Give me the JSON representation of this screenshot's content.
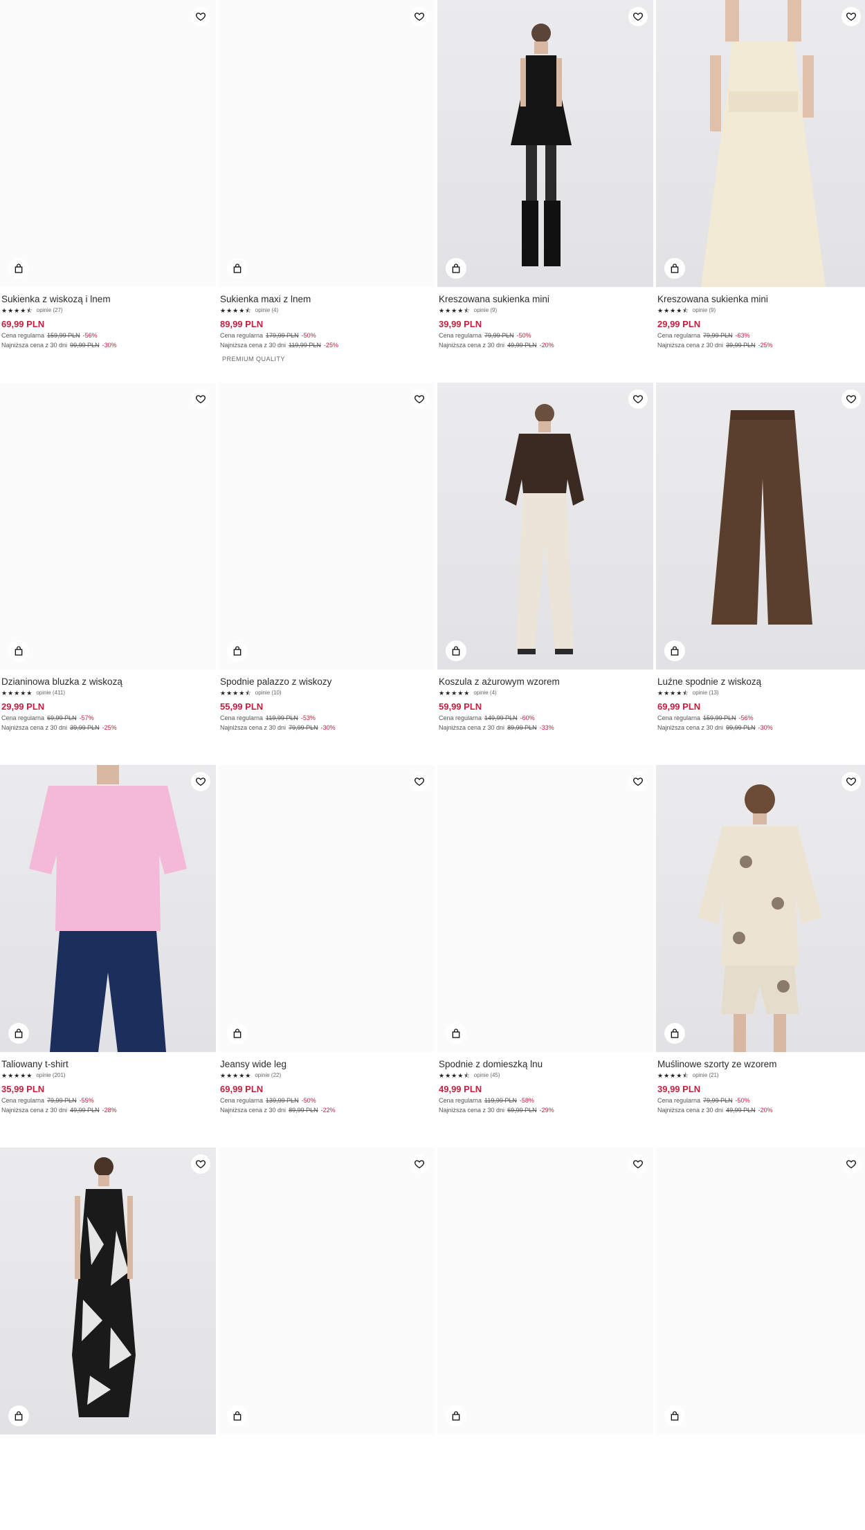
{
  "labels": {
    "regular": "Cena regularna",
    "lowest30": "Najniższa cena z 30 dni"
  },
  "colors": {
    "price": "#c3203f",
    "text": "#2b2b2b"
  },
  "icons": {
    "favorite": "heart-icon",
    "cart": "shopping-bag-icon",
    "star": "star-icon"
  },
  "products": [
    {
      "name": "Sukienka z wiskozą i lnem",
      "stars": "★★★★⯪",
      "reviews": "opinie (27)",
      "price": "69,99 PLN",
      "regular_price": "159,99 PLN",
      "regular_discount": "-56%",
      "lowest_price": "99,99 PLN",
      "lowest_discount": "-30%",
      "tag": ""
    },
    {
      "name": "Sukienka maxi z lnem",
      "stars": "★★★★⯪",
      "reviews": "opinie (4)",
      "price": "89,99 PLN",
      "regular_price": "179,99 PLN",
      "regular_discount": "-50%",
      "lowest_price": "119,99 PLN",
      "lowest_discount": "-25%",
      "tag": "PREMIUM QUALITY"
    },
    {
      "name": "Kreszowana sukienka mini",
      "stars": "★★★★⯪",
      "reviews": "opinie (9)",
      "price": "39,99 PLN",
      "regular_price": "79,99 PLN",
      "regular_discount": "-50%",
      "lowest_price": "49,99 PLN",
      "lowest_discount": "-20%",
      "tag": ""
    },
    {
      "name": "Kreszowana sukienka mini",
      "stars": "★★★★⯪",
      "reviews": "opinie (9)",
      "price": "29,99 PLN",
      "regular_price": "79,99 PLN",
      "regular_discount": "-63%",
      "lowest_price": "39,99 PLN",
      "lowest_discount": "-25%",
      "tag": ""
    },
    {
      "name": "Dzianinowa bluzka z wiskozą",
      "stars": "★★★★★",
      "reviews": "opinie (411)",
      "price": "29,99 PLN",
      "regular_price": "69,99 PLN",
      "regular_discount": "-57%",
      "lowest_price": "39,99 PLN",
      "lowest_discount": "-25%",
      "tag": ""
    },
    {
      "name": "Spodnie palazzo z wiskozy",
      "stars": "★★★★⯪",
      "reviews": "opinie (10)",
      "price": "55,99 PLN",
      "regular_price": "119,99 PLN",
      "regular_discount": "-53%",
      "lowest_price": "79,99 PLN",
      "lowest_discount": "-30%",
      "tag": ""
    },
    {
      "name": "Koszula z ażurowym wzorem",
      "stars": "★★★★★",
      "reviews": "opinie (4)",
      "price": "59,99 PLN",
      "regular_price": "149,99 PLN",
      "regular_discount": "-60%",
      "lowest_price": "89,99 PLN",
      "lowest_discount": "-33%",
      "tag": ""
    },
    {
      "name": "Luźne spodnie z wiskozą",
      "stars": "★★★★⯪",
      "reviews": "opinie (13)",
      "price": "69,99 PLN",
      "regular_price": "159,99 PLN",
      "regular_discount": "-56%",
      "lowest_price": "99,99 PLN",
      "lowest_discount": "-30%",
      "tag": ""
    },
    {
      "name": "Taliowany t-shirt",
      "stars": "★★★★★",
      "reviews": "opinie (201)",
      "price": "35,99 PLN",
      "regular_price": "79,99 PLN",
      "regular_discount": "-55%",
      "lowest_price": "49,99 PLN",
      "lowest_discount": "-28%",
      "tag": ""
    },
    {
      "name": "Jeansy wide leg",
      "stars": "★★★★★",
      "reviews": "opinie (22)",
      "price": "69,99 PLN",
      "regular_price": "139,99 PLN",
      "regular_discount": "-50%",
      "lowest_price": "89,99 PLN",
      "lowest_discount": "-22%",
      "tag": ""
    },
    {
      "name": "Spodnie z domieszką lnu",
      "stars": "★★★★⯪",
      "reviews": "opinie (45)",
      "price": "49,99 PLN",
      "regular_price": "119,99 PLN",
      "regular_discount": "-58%",
      "lowest_price": "69,99 PLN",
      "lowest_discount": "-29%",
      "tag": ""
    },
    {
      "name": "Muślinowe szorty ze wzorem",
      "stars": "★★★★⯪",
      "reviews": "opinie (21)",
      "price": "39,99 PLN",
      "regular_price": "79,99 PLN",
      "regular_discount": "-50%",
      "lowest_price": "49,99 PLN",
      "lowest_discount": "-20%",
      "tag": ""
    }
  ]
}
